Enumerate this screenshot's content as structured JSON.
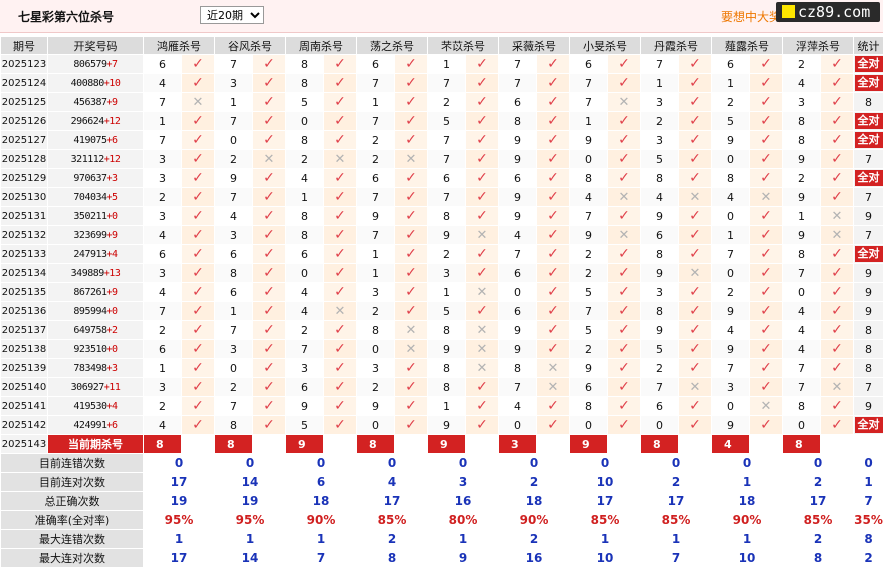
{
  "header": {
    "title": "七星彩第六位杀号",
    "period_select": "近20期",
    "promo_text": "要想中大奖",
    "brand": "cz89.com"
  },
  "table": {
    "columns": {
      "period": "期号",
      "numbers": "开奖号码",
      "experts": [
        "鸿雁杀号",
        "谷风杀号",
        "周南杀号",
        "荡之杀号",
        "芣苡杀号",
        "采薇杀号",
        "小旻杀号",
        "丹霞杀号",
        "薤露杀号",
        "浮萍杀号"
      ],
      "stat": "统计"
    },
    "rows": [
      {
        "period": "2025123",
        "digits": "806579",
        "sum": "+7",
        "kills": [
          "6",
          "7",
          "8",
          "6",
          "1",
          "7",
          "6",
          "7",
          "6",
          "2"
        ],
        "hits": [
          "ok",
          "ok",
          "ok",
          "ok",
          "ok",
          "ok",
          "ok",
          "ok",
          "ok",
          "ok"
        ],
        "stat": "全对"
      },
      {
        "period": "2025124",
        "digits": "400880",
        "sum": "+10",
        "kills": [
          "4",
          "3",
          "8",
          "7",
          "7",
          "7",
          "7",
          "1",
          "1",
          "4"
        ],
        "hits": [
          "ok",
          "ok",
          "ok",
          "ok",
          "ok",
          "ok",
          "ok",
          "ok",
          "ok",
          "ok"
        ],
        "stat": "全对"
      },
      {
        "period": "2025125",
        "digits": "456387",
        "sum": "+9",
        "kills": [
          "7",
          "1",
          "5",
          "1",
          "2",
          "6",
          "7",
          "3",
          "2",
          "3"
        ],
        "hits": [
          "no",
          "ok",
          "ok",
          "ok",
          "ok",
          "ok",
          "no",
          "ok",
          "ok",
          "ok"
        ],
        "stat": "8"
      },
      {
        "period": "2025126",
        "digits": "296624",
        "sum": "+12",
        "kills": [
          "1",
          "7",
          "0",
          "7",
          "5",
          "8",
          "1",
          "2",
          "5",
          "8"
        ],
        "hits": [
          "ok",
          "ok",
          "ok",
          "ok",
          "ok",
          "ok",
          "ok",
          "ok",
          "ok",
          "ok"
        ],
        "stat": "全对"
      },
      {
        "period": "2025127",
        "digits": "419075",
        "sum": "+6",
        "kills": [
          "7",
          "0",
          "8",
          "2",
          "7",
          "9",
          "9",
          "3",
          "9",
          "8"
        ],
        "hits": [
          "ok",
          "ok",
          "ok",
          "ok",
          "ok",
          "ok",
          "ok",
          "ok",
          "ok",
          "ok"
        ],
        "stat": "全对"
      },
      {
        "period": "2025128",
        "digits": "321112",
        "sum": "+12",
        "kills": [
          "3",
          "2",
          "2",
          "2",
          "7",
          "9",
          "0",
          "5",
          "0",
          "9"
        ],
        "hits": [
          "ok",
          "no",
          "no",
          "no",
          "ok",
          "ok",
          "ok",
          "ok",
          "ok",
          "ok"
        ],
        "stat": "7"
      },
      {
        "period": "2025129",
        "digits": "970637",
        "sum": "+3",
        "kills": [
          "3",
          "9",
          "4",
          "6",
          "6",
          "6",
          "8",
          "8",
          "8",
          "2"
        ],
        "hits": [
          "ok",
          "ok",
          "ok",
          "ok",
          "ok",
          "ok",
          "ok",
          "ok",
          "ok",
          "ok"
        ],
        "stat": "全对"
      },
      {
        "period": "2025130",
        "digits": "704034",
        "sum": "+5",
        "kills": [
          "2",
          "7",
          "1",
          "7",
          "7",
          "9",
          "4",
          "4",
          "4",
          "9"
        ],
        "hits": [
          "ok",
          "ok",
          "ok",
          "ok",
          "ok",
          "ok",
          "no",
          "no",
          "no",
          "ok"
        ],
        "stat": "7"
      },
      {
        "period": "2025131",
        "digits": "350211",
        "sum": "+0",
        "kills": [
          "3",
          "4",
          "8",
          "9",
          "8",
          "9",
          "7",
          "9",
          "0",
          "1"
        ],
        "hits": [
          "ok",
          "ok",
          "ok",
          "ok",
          "ok",
          "ok",
          "ok",
          "ok",
          "ok",
          "no"
        ],
        "stat": "9"
      },
      {
        "period": "2025132",
        "digits": "323699",
        "sum": "+9",
        "kills": [
          "4",
          "3",
          "8",
          "7",
          "9",
          "4",
          "9",
          "6",
          "1",
          "9"
        ],
        "hits": [
          "ok",
          "ok",
          "ok",
          "ok",
          "no",
          "ok",
          "no",
          "ok",
          "ok",
          "no"
        ],
        "stat": "7"
      },
      {
        "period": "2025133",
        "digits": "247913",
        "sum": "+4",
        "kills": [
          "6",
          "6",
          "6",
          "1",
          "2",
          "7",
          "2",
          "8",
          "7",
          "8"
        ],
        "hits": [
          "ok",
          "ok",
          "ok",
          "ok",
          "ok",
          "ok",
          "ok",
          "ok",
          "ok",
          "ok"
        ],
        "stat": "全对"
      },
      {
        "period": "2025134",
        "digits": "349889",
        "sum": "+13",
        "kills": [
          "3",
          "8",
          "0",
          "1",
          "3",
          "6",
          "2",
          "9",
          "0",
          "7"
        ],
        "hits": [
          "ok",
          "ok",
          "ok",
          "ok",
          "ok",
          "ok",
          "ok",
          "no",
          "ok",
          "ok"
        ],
        "stat": "9"
      },
      {
        "period": "2025135",
        "digits": "867261",
        "sum": "+9",
        "kills": [
          "4",
          "6",
          "4",
          "3",
          "1",
          "0",
          "5",
          "3",
          "2",
          "0"
        ],
        "hits": [
          "ok",
          "ok",
          "ok",
          "ok",
          "no",
          "ok",
          "ok",
          "ok",
          "ok",
          "ok"
        ],
        "stat": "9"
      },
      {
        "period": "2025136",
        "digits": "895994",
        "sum": "+0",
        "kills": [
          "7",
          "1",
          "4",
          "2",
          "5",
          "6",
          "7",
          "8",
          "9",
          "4"
        ],
        "hits": [
          "ok",
          "ok",
          "no",
          "ok",
          "ok",
          "ok",
          "ok",
          "ok",
          "ok",
          "ok"
        ],
        "stat": "9"
      },
      {
        "period": "2025137",
        "digits": "649758",
        "sum": "+2",
        "kills": [
          "2",
          "7",
          "2",
          "8",
          "8",
          "9",
          "5",
          "9",
          "4",
          "4"
        ],
        "hits": [
          "ok",
          "ok",
          "ok",
          "no",
          "no",
          "ok",
          "ok",
          "ok",
          "ok",
          "ok"
        ],
        "stat": "8"
      },
      {
        "period": "2025138",
        "digits": "923510",
        "sum": "+0",
        "kills": [
          "6",
          "3",
          "7",
          "0",
          "9",
          "9",
          "2",
          "5",
          "9",
          "4"
        ],
        "hits": [
          "ok",
          "ok",
          "ok",
          "no",
          "no",
          "ok",
          "ok",
          "ok",
          "ok",
          "ok"
        ],
        "stat": "8"
      },
      {
        "period": "2025139",
        "digits": "783498",
        "sum": "+3",
        "kills": [
          "1",
          "0",
          "3",
          "3",
          "8",
          "8",
          "9",
          "2",
          "7",
          "7"
        ],
        "hits": [
          "ok",
          "ok",
          "ok",
          "ok",
          "no",
          "no",
          "ok",
          "ok",
          "ok",
          "ok"
        ],
        "stat": "8"
      },
      {
        "period": "2025140",
        "digits": "306927",
        "sum": "+11",
        "kills": [
          "3",
          "2",
          "6",
          "2",
          "8",
          "7",
          "6",
          "7",
          "3",
          "7"
        ],
        "hits": [
          "ok",
          "ok",
          "ok",
          "ok",
          "ok",
          "no",
          "ok",
          "no",
          "ok",
          "no"
        ],
        "stat": "7"
      },
      {
        "period": "2025141",
        "digits": "419530",
        "sum": "+4",
        "kills": [
          "2",
          "7",
          "9",
          "9",
          "1",
          "4",
          "8",
          "6",
          "0",
          "8"
        ],
        "hits": [
          "ok",
          "ok",
          "ok",
          "ok",
          "ok",
          "ok",
          "ok",
          "ok",
          "no",
          "ok"
        ],
        "stat": "9"
      },
      {
        "period": "2025142",
        "digits": "424991",
        "sum": "+6",
        "kills": [
          "4",
          "8",
          "5",
          "0",
          "9",
          "0",
          "0",
          "0",
          "9",
          "0"
        ],
        "hits": [
          "ok",
          "ok",
          "ok",
          "ok",
          "ok",
          "ok",
          "ok",
          "ok",
          "ok",
          "ok"
        ],
        "stat": "全对"
      }
    ],
    "current": {
      "period": "2025143",
      "label": "当前期杀号",
      "kills": [
        "8",
        "8",
        "9",
        "8",
        "9",
        "3",
        "9",
        "8",
        "4",
        "8"
      ]
    },
    "stats": [
      {
        "label": "目前连错次数",
        "values": [
          "0",
          "0",
          "0",
          "0",
          "0",
          "0",
          "0",
          "0",
          "0",
          "0"
        ],
        "total": "0"
      },
      {
        "label": "目前连对次数",
        "values": [
          "17",
          "14",
          "6",
          "4",
          "3",
          "2",
          "10",
          "2",
          "1",
          "2"
        ],
        "total": "1"
      },
      {
        "label": "总正确次数",
        "values": [
          "19",
          "19",
          "18",
          "17",
          "16",
          "18",
          "17",
          "17",
          "18",
          "17"
        ],
        "total": "7"
      },
      {
        "label": "准确率(全对率)",
        "values": [
          "95%",
          "95%",
          "90%",
          "85%",
          "80%",
          "90%",
          "85%",
          "85%",
          "90%",
          "85%"
        ],
        "total": "35%"
      },
      {
        "label": "最大连错次数",
        "values": [
          "1",
          "1",
          "1",
          "2",
          "1",
          "2",
          "1",
          "1",
          "1",
          "2"
        ],
        "total": "8"
      },
      {
        "label": "最大连对次数",
        "values": [
          "17",
          "14",
          "7",
          "8",
          "9",
          "16",
          "10",
          "7",
          "10",
          "8"
        ],
        "total": "2"
      }
    ]
  }
}
